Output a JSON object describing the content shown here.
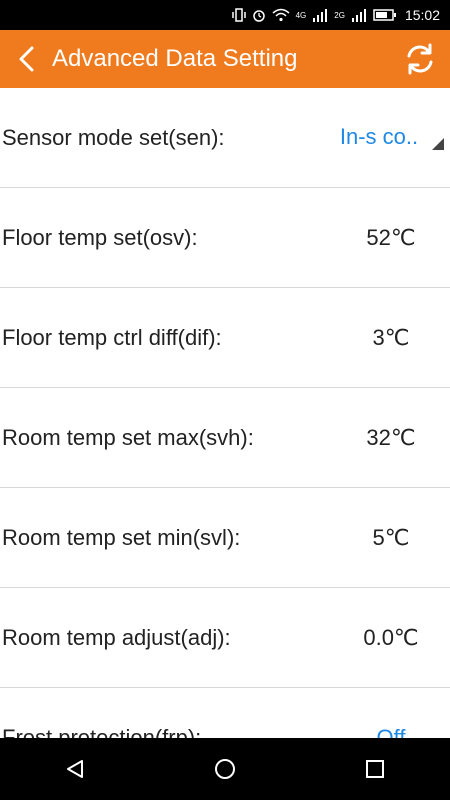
{
  "status_bar": {
    "time": "15:02",
    "sim1_label": "4G",
    "sim2_label": "2G"
  },
  "header": {
    "title": "Advanced Data Setting"
  },
  "settings": [
    {
      "label": "Sensor mode set(sen):",
      "value": "In-s co.."
    },
    {
      "label": "Floor temp set(osv):",
      "value": "52℃"
    },
    {
      "label": "Floor temp ctrl diff(dif):",
      "value": "3℃"
    },
    {
      "label": "Room temp set max(svh):",
      "value": "32℃"
    },
    {
      "label": "Room temp set min(svl):",
      "value": "5℃"
    },
    {
      "label": "Room temp adjust(adj):",
      "value": "0.0℃"
    },
    {
      "label": "Frost protection(frp):",
      "value": "Off"
    }
  ],
  "colors": {
    "accent": "#f07a1e",
    "link": "#1e88e5"
  }
}
